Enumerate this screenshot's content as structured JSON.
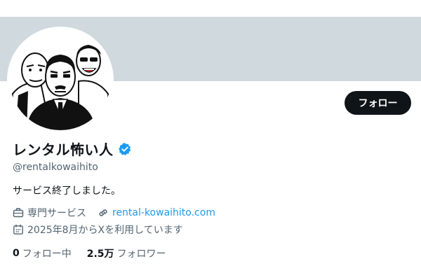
{
  "colors": {
    "banner": "#cfd9de",
    "accent": "#1d9bf0",
    "text": "#0f1419",
    "muted": "#536471",
    "follow_button_bg": "#0f1419"
  },
  "profile": {
    "display_name": "レンタル怖い人",
    "verified_icon": "verified-badge-icon",
    "handle": "@rentalkowaihito",
    "bio": "サービス終了しました。",
    "avatar_icon": "avatar-illustration"
  },
  "actions": {
    "follow_label": "フォロー"
  },
  "meta": {
    "category": {
      "icon": "briefcase-icon",
      "text": "専門サービス"
    },
    "website": {
      "icon": "link-icon",
      "text": "rental-kowaihito.com"
    },
    "joined": {
      "icon": "calendar-icon",
      "text": "2025年8月からXを利用しています"
    }
  },
  "stats": {
    "following": {
      "count": "0",
      "label": "フォロー中"
    },
    "followers": {
      "count": "2.5万",
      "label": "フォロワー"
    }
  }
}
